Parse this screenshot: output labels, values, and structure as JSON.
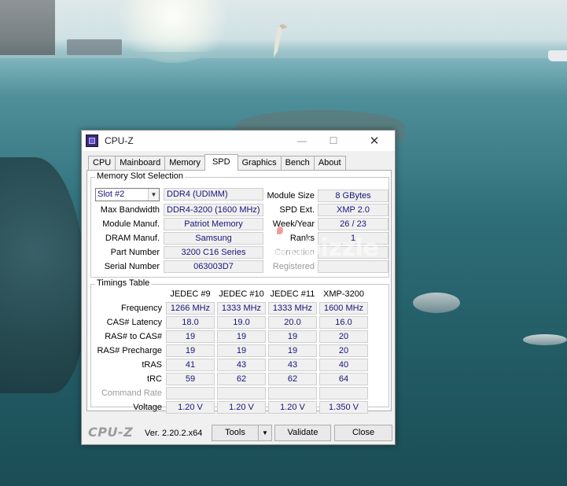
{
  "window": {
    "title": "CPU-Z",
    "minimize": "—",
    "maximize": "☐",
    "close": "✕"
  },
  "tabs": [
    "CPU",
    "Mainboard",
    "Memory",
    "SPD",
    "Graphics",
    "Bench",
    "About"
  ],
  "active_tab": "SPD",
  "memory_slot": {
    "legend": "Memory Slot Selection",
    "slot_selected": "Slot #2",
    "type": "DDR4 (UDIMM)",
    "max_bandwidth_label": "Max Bandwidth",
    "max_bandwidth": "DDR4-3200 (1600 MHz)",
    "module_manuf_label": "Module Manuf.",
    "module_manuf": "Patriot Memory",
    "dram_manuf_label": "DRAM Manuf.",
    "dram_manuf": "Samsung",
    "part_number_label": "Part Number",
    "part_number": "3200 C16 Series",
    "serial_number_label": "Serial Number",
    "serial_number": "063003D7",
    "module_size_label": "Module Size",
    "module_size": "8 GBytes",
    "spd_ext_label": "SPD Ext.",
    "spd_ext": "XMP 2.0",
    "week_year_label": "Week/Year",
    "week_year": "26 / 23",
    "ranks_label": "Ranks",
    "ranks": "1",
    "correction_label": "Correction",
    "registered_label": "Registered"
  },
  "timings": {
    "legend": "Timings Table",
    "columns": [
      "JEDEC #9",
      "JEDEC #10",
      "JEDEC #11",
      "XMP-3200"
    ],
    "rows": [
      {
        "label": "Frequency",
        "values": [
          "1266 MHz",
          "1333 MHz",
          "1333 MHz",
          "1600 MHz"
        ]
      },
      {
        "label": "CAS# Latency",
        "values": [
          "18.0",
          "19.0",
          "20.0",
          "16.0"
        ]
      },
      {
        "label": "RAS# to CAS#",
        "values": [
          "19",
          "19",
          "19",
          "20"
        ]
      },
      {
        "label": "RAS# Precharge",
        "values": [
          "19",
          "19",
          "19",
          "20"
        ]
      },
      {
        "label": "tRAS",
        "values": [
          "41",
          "43",
          "43",
          "40"
        ]
      },
      {
        "label": "tRC",
        "values": [
          "59",
          "62",
          "62",
          "64"
        ]
      },
      {
        "label": "Command Rate",
        "values": [
          "",
          "",
          "",
          ""
        ]
      },
      {
        "label": "Voltage",
        "values": [
          "1.20 V",
          "1.20 V",
          "1.20 V",
          "1.350 V"
        ]
      }
    ]
  },
  "footer": {
    "brand": "CPU-Z",
    "version": "Ver. 2.20.2.x64",
    "tools_label": "Tools",
    "validate_label": "Validate",
    "close_label": "Close"
  },
  "watermark": "dubizzle",
  "icons": {
    "app": "cpu-z-app-icon",
    "dropdown": "chevron-down-icon"
  }
}
